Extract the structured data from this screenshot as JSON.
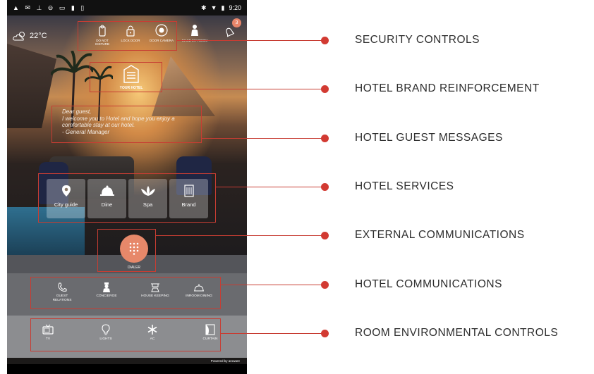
{
  "status_bar": {
    "left_icons": "▲ ✉ ⊥ ⊖ ▭ ▮ ▯",
    "time": "9:20"
  },
  "weather": {
    "temperature": "22°C",
    "icon": "cloud-sun-icon"
  },
  "security": [
    {
      "label": "DO NOT DISTURB",
      "icon": "door-hanger-icon"
    },
    {
      "label": "LOCK DOOR",
      "icon": "lock-icon"
    },
    {
      "label": "DOOR CAMERA",
      "icon": "camera-icon"
    }
  ],
  "make_room": {
    "label": "MAKE MY ROOM",
    "icon": "housekeeper-icon"
  },
  "notifications": {
    "count": "3",
    "icon": "bell-icon"
  },
  "brand": {
    "name": "YOUR HOTEL",
    "icon": "hotel-building-icon"
  },
  "guest_message": {
    "line1": "Dear guest,",
    "line2": "I welcome you to Hotel and hope you enjoy a",
    "line3": "comfortable stay at our hotel.",
    "line4": "- General Manager"
  },
  "services": [
    {
      "label": "City guide",
      "icon": "map-pin-icon"
    },
    {
      "label": "Dine",
      "icon": "cloche-icon"
    },
    {
      "label": "Spa",
      "icon": "lotus-icon"
    },
    {
      "label": "Brand",
      "icon": "building-icon"
    }
  ],
  "dialer": {
    "label": "DIALER",
    "icon": "keypad-icon"
  },
  "hotel_comms": [
    {
      "label": "GUEST RELATIONS",
      "icon": "phone-icon"
    },
    {
      "label": "CONCIERGE",
      "icon": "concierge-icon"
    },
    {
      "label": "HOUSE KEEPING",
      "icon": "housekeeping-icon"
    },
    {
      "label": "INROOM DINING",
      "icon": "dining-icon"
    }
  ],
  "room_env": [
    {
      "label": "TV",
      "icon": "tv-icon"
    },
    {
      "label": "LIGHTS",
      "icon": "bulb-icon"
    },
    {
      "label": "AC",
      "icon": "snowflake-icon"
    },
    {
      "label": "CURTAIN",
      "icon": "curtain-icon"
    }
  ],
  "powered_by": "Powered by aroware",
  "callouts": [
    "SECURITY CONTROLS",
    "HOTEL BRAND REINFORCEMENT",
    "HOTEL GUEST MESSAGES",
    "HOTEL SERVICES",
    "EXTERNAL COMMUNICATIONS",
    "HOTEL COMMUNICATIONS",
    "ROOM ENVIRONMENTAL CONTROLS"
  ],
  "colors": {
    "accent": "#c73d33",
    "dialer": "#e7886a"
  }
}
